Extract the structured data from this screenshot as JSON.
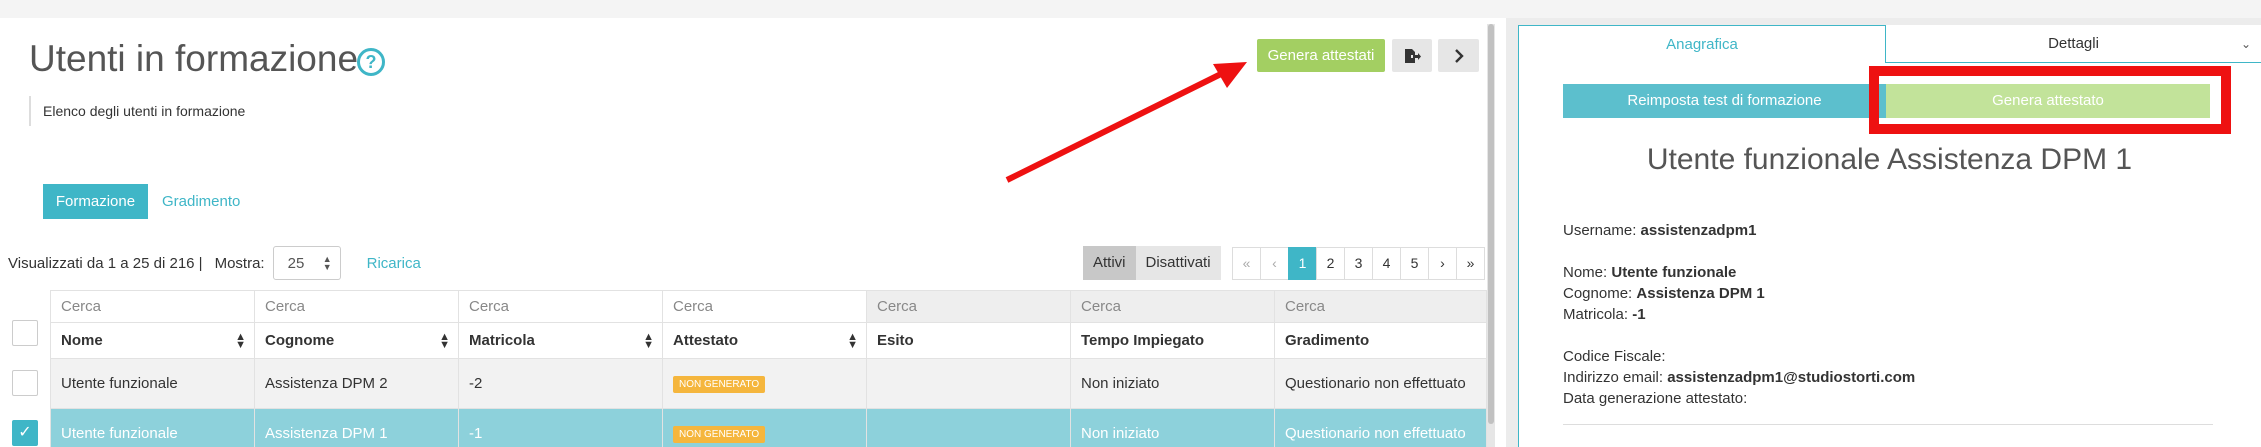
{
  "page": {
    "title": "Utenti in formazione",
    "subtitle": "Elenco degli utenti in formazione"
  },
  "toolbar": {
    "genera_attestati_label": "Genera attestati"
  },
  "tabs": [
    {
      "label": "Formazione",
      "active": true
    },
    {
      "label": "Gradimento",
      "active": false
    }
  ],
  "listing": {
    "info": "Visualizzati da 1 a 25 di 216 |",
    "mostra_label": "Mostra:",
    "mostra_value": "25",
    "ricarica": "Ricarica",
    "filter_active": "Attivi",
    "filter_inactive": "Disattivati"
  },
  "pagination": {
    "first": "«",
    "prev": "‹",
    "pages": [
      "1",
      "2",
      "3",
      "4",
      "5"
    ],
    "current": "1",
    "next": "›",
    "last": "»"
  },
  "table": {
    "search_placeholder": "Cerca",
    "columns": [
      "Nome",
      "Cognome",
      "Matricola",
      "Attestato",
      "Esito",
      "Tempo Impiegato",
      "Gradimento"
    ],
    "rows": [
      {
        "nome": "Utente funzionale",
        "cognome": "Assistenza DPM 2",
        "matricola": "-2",
        "attestato": "NON GENERATO",
        "esito": "",
        "tempo": "Non iniziato",
        "gradimento": "Questionario non effettuato",
        "selected": false
      },
      {
        "nome": "Utente funzionale",
        "cognome": "Assistenza DPM 1",
        "matricola": "-1",
        "attestato": "NON GENERATO",
        "esito": "",
        "tempo": "Non iniziato",
        "gradimento": "Questionario non effettuato",
        "selected": true
      }
    ]
  },
  "panel": {
    "tab_anagrafica": "Anagrafica",
    "tab_dettagli": "Dettagli",
    "btn_reimposta": "Reimposta test di formazione",
    "btn_genera": "Genera attestato",
    "user_title": "Utente funzionale Assistenza DPM 1",
    "username_label": "Username:",
    "username": "assistenzadpm1",
    "nome_label": "Nome:",
    "nome": "Utente funzionale",
    "cognome_label": "Cognome:",
    "cognome": "Assistenza DPM 1",
    "matricola_label": "Matricola:",
    "matricola": "-1",
    "cf_label": "Codice Fiscale:",
    "email_label": "Indirizzo email:",
    "email": "assistenzadpm1@studiostorti.com",
    "data_label": "Data generazione attestato:"
  },
  "colors": {
    "accent": "#3fb6c7",
    "green": "#a3cf62",
    "annotation_red": "#ee1111",
    "badge": "#f5b63d"
  }
}
